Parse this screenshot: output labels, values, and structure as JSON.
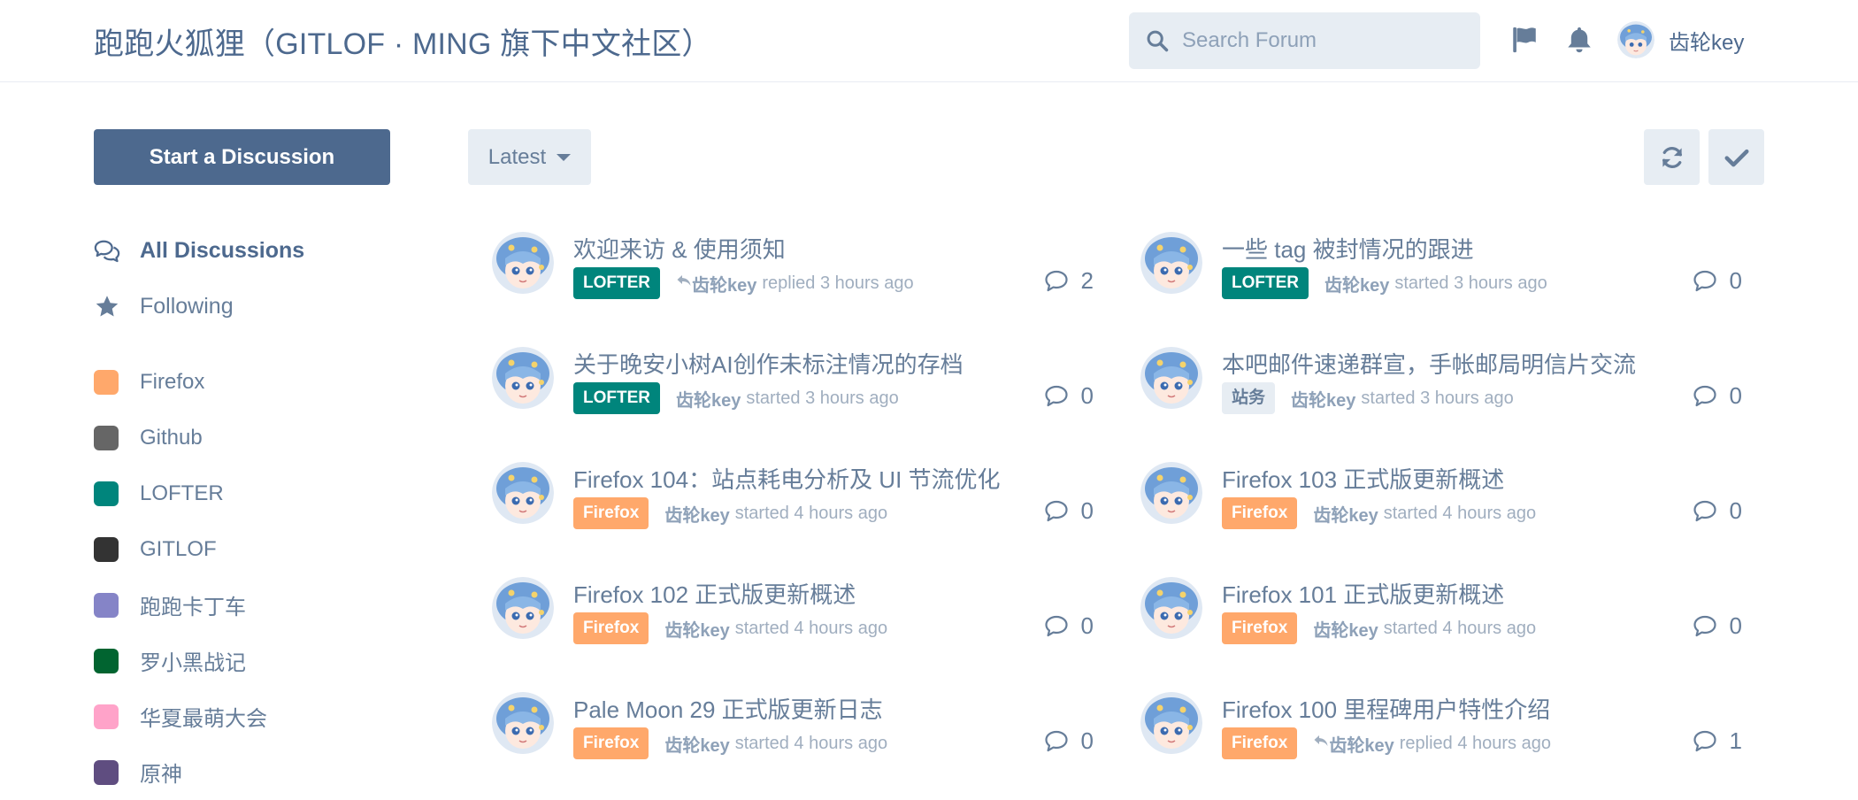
{
  "header": {
    "site_title": "跑跑火狐狸（GITLOF · MING 旗下中文社区）",
    "search_placeholder": "Search Forum",
    "username": "齿轮key"
  },
  "sidebar": {
    "start_button": "Start a Discussion",
    "nav": [
      {
        "label": "All Discussions",
        "icon": "comments-icon"
      },
      {
        "label": "Following",
        "icon": "star-icon"
      }
    ],
    "tags": [
      {
        "label": "Firefox",
        "color": "#ffa86b"
      },
      {
        "label": "Github",
        "color": "#666666"
      },
      {
        "label": "LOFTER",
        "color": "#00857c"
      },
      {
        "label": "GITLOF",
        "color": "#333333"
      },
      {
        "label": "跑跑卡丁车",
        "color": "#8584c7"
      },
      {
        "label": "罗小黑战记",
        "color": "#016430"
      },
      {
        "label": "华夏最萌大会",
        "color": "#ffa3c9"
      },
      {
        "label": "原神",
        "color": "#5f4d80"
      }
    ]
  },
  "toolbar": {
    "sort_label": "Latest"
  },
  "discussions": [
    {
      "title": "欢迎来访 & 使用须知",
      "tag": "LOFTER",
      "tag_color": "#00857c",
      "tag_text_color": "#ffffff",
      "user": "齿轮key",
      "action": "replied 3 hours ago",
      "replied": true,
      "count": "2"
    },
    {
      "title": "一些 tag 被封情况的跟进",
      "tag": "LOFTER",
      "tag_color": "#00857c",
      "tag_text_color": "#ffffff",
      "user": "齿轮key",
      "action": "started 3 hours ago",
      "replied": false,
      "count": "0"
    },
    {
      "title": "关于晚安小树AI创作未标注情况的存档",
      "tag": "LOFTER",
      "tag_color": "#00857c",
      "tag_text_color": "#ffffff",
      "user": "齿轮key",
      "action": "started 3 hours ago",
      "replied": false,
      "count": "0"
    },
    {
      "title": "本吧邮件速递群宣，手帐邮局明信片交流",
      "tag": "站务",
      "tag_color": "#e7edf3",
      "tag_text_color": "#667d99",
      "user": "齿轮key",
      "action": "started 3 hours ago",
      "replied": false,
      "count": "0"
    },
    {
      "title": "Firefox 104：站点耗电分析及 UI 节流优化",
      "tag": "Firefox",
      "tag_color": "#ffa86b",
      "tag_text_color": "#ffffff",
      "user": "齿轮key",
      "action": "started 4 hours ago",
      "replied": false,
      "count": "0"
    },
    {
      "title": "Firefox 103 正式版更新概述",
      "tag": "Firefox",
      "tag_color": "#ffa86b",
      "tag_text_color": "#ffffff",
      "user": "齿轮key",
      "action": "started 4 hours ago",
      "replied": false,
      "count": "0"
    },
    {
      "title": "Firefox 102 正式版更新概述",
      "tag": "Firefox",
      "tag_color": "#ffa86b",
      "tag_text_color": "#ffffff",
      "user": "齿轮key",
      "action": "started 4 hours ago",
      "replied": false,
      "count": "0"
    },
    {
      "title": "Firefox 101 正式版更新概述",
      "tag": "Firefox",
      "tag_color": "#ffa86b",
      "tag_text_color": "#ffffff",
      "user": "齿轮key",
      "action": "started 4 hours ago",
      "replied": false,
      "count": "0"
    },
    {
      "title": "Pale Moon 29 正式版更新日志",
      "tag": "Firefox",
      "tag_color": "#ffa86b",
      "tag_text_color": "#ffffff",
      "user": "齿轮key",
      "action": "started 4 hours ago",
      "replied": false,
      "count": "0"
    },
    {
      "title": "Firefox 100 里程碑用户特性介绍",
      "tag": "Firefox",
      "tag_color": "#ffa86b",
      "tag_text_color": "#ffffff",
      "user": "齿轮key",
      "action": "replied 4 hours ago",
      "replied": true,
      "count": "1"
    }
  ]
}
